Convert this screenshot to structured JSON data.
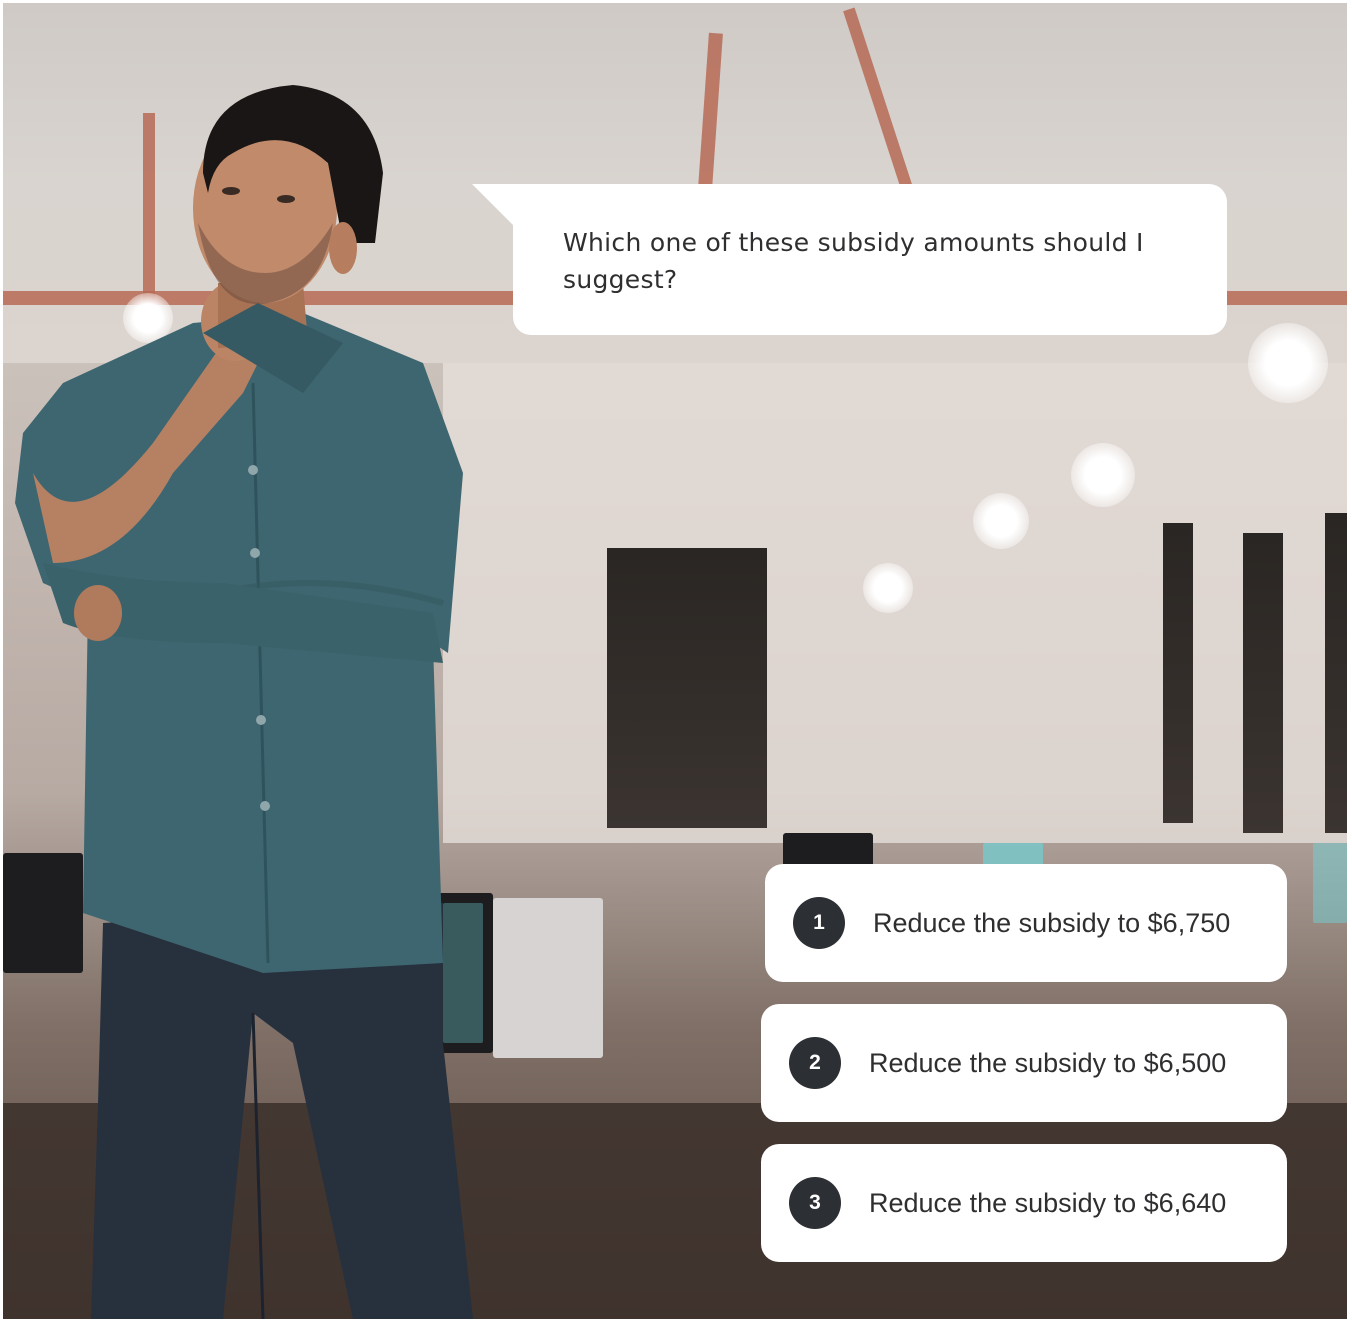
{
  "question": "Which one of these subsidy amounts should I suggest?",
  "options": [
    {
      "number": "1",
      "label": "Reduce the subsidy to $6,750"
    },
    {
      "number": "2",
      "label": "Reduce the subsidy to $6,500"
    },
    {
      "number": "3",
      "label": "Reduce the subsidy to $6,640"
    }
  ],
  "colors": {
    "badge": "#2c2f33",
    "card": "#ffffff",
    "text": "#2f2f32",
    "shirt": "#3e6670",
    "jeans": "#27303d"
  }
}
